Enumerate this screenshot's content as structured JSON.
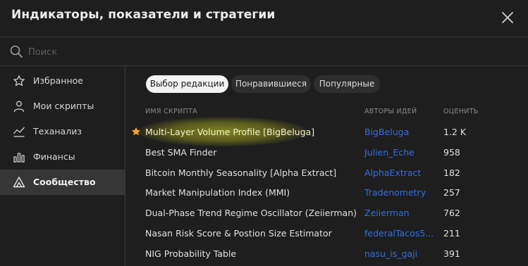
{
  "dialog": {
    "title": "Индикаторы, показатели и стратегии"
  },
  "search": {
    "placeholder": "Поиск",
    "value": ""
  },
  "sidebar": {
    "items": [
      {
        "label": "Избранное",
        "icon": "star-icon"
      },
      {
        "label": "Мои скрипты",
        "icon": "user-icon"
      },
      {
        "label": "Теханализ",
        "icon": "chart-icon"
      },
      {
        "label": "Финансы",
        "icon": "bar-chart-icon"
      },
      {
        "label": "Сообщество",
        "icon": "community-icon",
        "active": true
      }
    ]
  },
  "tabs": [
    {
      "label": "Выбор редакции",
      "active": true
    },
    {
      "label": "Понравившиеся"
    },
    {
      "label": "Популярные"
    }
  ],
  "columns": {
    "name": "ИМЯ СКРИПТА",
    "authors": "АВТОРЫ ИДЕЙ",
    "rating": "ОЦЕНИТЬ"
  },
  "rows": [
    {
      "name": "Multi-Layer Volume Profile [BigBeluga]",
      "author": "BigBeluga",
      "rating": "1.2 K",
      "favorite": true
    },
    {
      "name": "Best SMA Finder",
      "author": "Julien_Eche",
      "rating": "958"
    },
    {
      "name": "Bitcoin Monthly Seasonality [Alpha Extract]",
      "author": "AlphaExtract",
      "rating": "182"
    },
    {
      "name": "Market Manipulation Index (MMI)",
      "author": "Tradenometry",
      "rating": "257"
    },
    {
      "name": "Dual-Phase Trend Regime Oscillator (Zeiierman)",
      "author": "Zeiierman",
      "rating": "762"
    },
    {
      "name": "Nasan Risk Score & Postion Size Estimator",
      "author": "federalTacos5...",
      "rating": "211"
    },
    {
      "name": "NIG Probability Table",
      "author": "nasu_is_gaji",
      "rating": "391"
    }
  ],
  "colors": {
    "background": "#1e1e1e",
    "author_link": "#2f6fe8",
    "favorite_star": "#f5a623",
    "highlight": "#d7d728"
  }
}
